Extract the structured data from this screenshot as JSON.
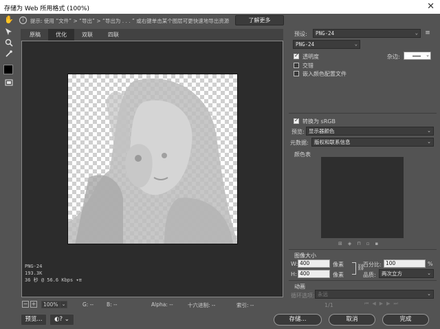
{
  "window": {
    "title": "存储为 Web 所用格式 (100%)",
    "close_glyph": "✕"
  },
  "hint": {
    "text": "提示: 使用 “文件” > “导出” > “导出为 . . . ” 或右键单击某个图层可更快速地导出资源",
    "learn_more": "了解更多"
  },
  "tabs": [
    {
      "label": "原稿",
      "active": false
    },
    {
      "label": "优化",
      "active": true
    },
    {
      "label": "双联",
      "active": false
    },
    {
      "label": "四联",
      "active": false
    }
  ],
  "canvas_info": {
    "format": "PNG-24",
    "size": "193.3K",
    "time": "36 秒 @ 56.6 Kbps"
  },
  "statusbar": {
    "zoom": "100%",
    "g": "G: --",
    "b": "B: --",
    "alpha": "Alpha: --",
    "hex": "十六进制: --",
    "index": "索引: --"
  },
  "buttons": {
    "preview": "预览...",
    "save": "存储...",
    "cancel": "取消",
    "done": "完成"
  },
  "settings": {
    "preset_label": "预设:",
    "preset_value": "PNG-24",
    "format_value": "PNG-24",
    "transparency_label": "透明度",
    "transparency_checked": true,
    "matte_label": "杂边:",
    "interlaced_label": "交错",
    "interlaced_checked": false,
    "embed_profile_label": "嵌入颜色配置文件",
    "embed_profile_checked": false,
    "convert_srgb_label": "转换为 sRGB",
    "convert_srgb_checked": true,
    "preview_label": "预览:",
    "preview_value": "显示器颜色",
    "metadata_label": "元数据:",
    "metadata_value": "版权和联系信息",
    "color_table_label": "颜色表"
  },
  "image_size": {
    "title": "图像大小",
    "w_label": "W:",
    "w_value": "400",
    "h_label": "H:",
    "h_value": "400",
    "unit": "像素",
    "percent_label": "百分比:",
    "percent_value": "100",
    "percent_unit": "%",
    "quality_label": "品质:",
    "quality_value": "两次立方"
  },
  "animation": {
    "title": "动画",
    "loop_label": "循环选项:",
    "loop_value": "永远",
    "frame_counter": "1/1"
  }
}
